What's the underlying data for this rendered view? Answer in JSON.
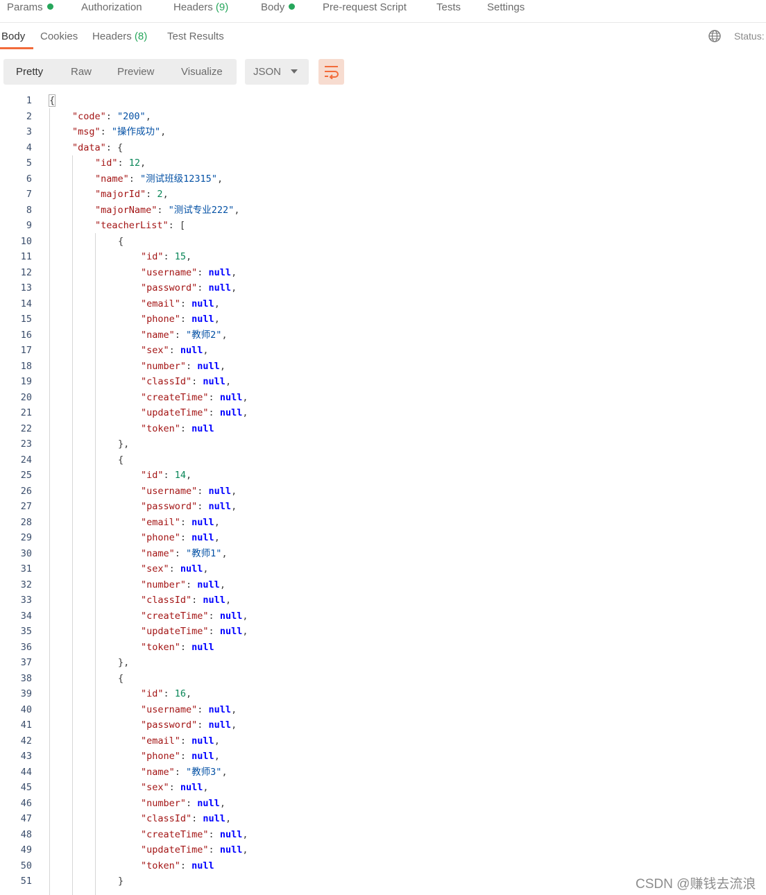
{
  "request_tabs": [
    {
      "label": "Params",
      "dot": true
    },
    {
      "label": "Authorization"
    },
    {
      "label": "Headers",
      "count": "(9)"
    },
    {
      "label": "Body",
      "dot": true
    },
    {
      "label": "Pre-request Script"
    },
    {
      "label": "Tests"
    },
    {
      "label": "Settings"
    }
  ],
  "response_tabs": [
    {
      "label": "Body",
      "active": true
    },
    {
      "label": "Cookies"
    },
    {
      "label": "Headers",
      "count": "(8)"
    },
    {
      "label": "Test Results"
    }
  ],
  "status_label": "Status:",
  "view_modes": [
    {
      "label": "Pretty",
      "active": true
    },
    {
      "label": "Raw"
    },
    {
      "label": "Preview"
    },
    {
      "label": "Visualize"
    }
  ],
  "format": {
    "selected": "JSON"
  },
  "icons": {
    "globe": "globe-icon",
    "wrap": "wrap-lines-icon",
    "format_caret": "chevron-down-icon"
  },
  "colors": {
    "accent": "#f26b3a",
    "count": "#26a65b",
    "key": "#a31515",
    "string": "#0451a5",
    "number": "#098658",
    "null": "#0000ff"
  },
  "code_lines": [
    [
      {
        "t": "p",
        "v": "{"
      }
    ],
    [
      {
        "t": "k",
        "v": "\"code\""
      },
      {
        "t": "p",
        "v": ": "
      },
      {
        "t": "s",
        "v": "\"200\""
      },
      {
        "t": "p",
        "v": ","
      }
    ],
    [
      {
        "t": "k",
        "v": "\"msg\""
      },
      {
        "t": "p",
        "v": ": "
      },
      {
        "t": "s",
        "v": "\"操作成功\""
      },
      {
        "t": "p",
        "v": ","
      }
    ],
    [
      {
        "t": "k",
        "v": "\"data\""
      },
      {
        "t": "p",
        "v": ": {"
      }
    ],
    [
      {
        "t": "k",
        "v": "\"id\""
      },
      {
        "t": "p",
        "v": ": "
      },
      {
        "t": "n",
        "v": "12"
      },
      {
        "t": "p",
        "v": ","
      }
    ],
    [
      {
        "t": "k",
        "v": "\"name\""
      },
      {
        "t": "p",
        "v": ": "
      },
      {
        "t": "s",
        "v": "\"测试班级12315\""
      },
      {
        "t": "p",
        "v": ","
      }
    ],
    [
      {
        "t": "k",
        "v": "\"majorId\""
      },
      {
        "t": "p",
        "v": ": "
      },
      {
        "t": "n",
        "v": "2"
      },
      {
        "t": "p",
        "v": ","
      }
    ],
    [
      {
        "t": "k",
        "v": "\"majorName\""
      },
      {
        "t": "p",
        "v": ": "
      },
      {
        "t": "s",
        "v": "\"测试专业222\""
      },
      {
        "t": "p",
        "v": ","
      }
    ],
    [
      {
        "t": "k",
        "v": "\"teacherList\""
      },
      {
        "t": "p",
        "v": ": ["
      }
    ],
    [
      {
        "t": "p",
        "v": "{"
      }
    ],
    [
      {
        "t": "k",
        "v": "\"id\""
      },
      {
        "t": "p",
        "v": ": "
      },
      {
        "t": "n",
        "v": "15"
      },
      {
        "t": "p",
        "v": ","
      }
    ],
    [
      {
        "t": "k",
        "v": "\"username\""
      },
      {
        "t": "p",
        "v": ": "
      },
      {
        "t": "x",
        "v": "null"
      },
      {
        "t": "p",
        "v": ","
      }
    ],
    [
      {
        "t": "k",
        "v": "\"password\""
      },
      {
        "t": "p",
        "v": ": "
      },
      {
        "t": "x",
        "v": "null"
      },
      {
        "t": "p",
        "v": ","
      }
    ],
    [
      {
        "t": "k",
        "v": "\"email\""
      },
      {
        "t": "p",
        "v": ": "
      },
      {
        "t": "x",
        "v": "null"
      },
      {
        "t": "p",
        "v": ","
      }
    ],
    [
      {
        "t": "k",
        "v": "\"phone\""
      },
      {
        "t": "p",
        "v": ": "
      },
      {
        "t": "x",
        "v": "null"
      },
      {
        "t": "p",
        "v": ","
      }
    ],
    [
      {
        "t": "k",
        "v": "\"name\""
      },
      {
        "t": "p",
        "v": ": "
      },
      {
        "t": "s",
        "v": "\"教师2\""
      },
      {
        "t": "p",
        "v": ","
      }
    ],
    [
      {
        "t": "k",
        "v": "\"sex\""
      },
      {
        "t": "p",
        "v": ": "
      },
      {
        "t": "x",
        "v": "null"
      },
      {
        "t": "p",
        "v": ","
      }
    ],
    [
      {
        "t": "k",
        "v": "\"number\""
      },
      {
        "t": "p",
        "v": ": "
      },
      {
        "t": "x",
        "v": "null"
      },
      {
        "t": "p",
        "v": ","
      }
    ],
    [
      {
        "t": "k",
        "v": "\"classId\""
      },
      {
        "t": "p",
        "v": ": "
      },
      {
        "t": "x",
        "v": "null"
      },
      {
        "t": "p",
        "v": ","
      }
    ],
    [
      {
        "t": "k",
        "v": "\"createTime\""
      },
      {
        "t": "p",
        "v": ": "
      },
      {
        "t": "x",
        "v": "null"
      },
      {
        "t": "p",
        "v": ","
      }
    ],
    [
      {
        "t": "k",
        "v": "\"updateTime\""
      },
      {
        "t": "p",
        "v": ": "
      },
      {
        "t": "x",
        "v": "null"
      },
      {
        "t": "p",
        "v": ","
      }
    ],
    [
      {
        "t": "k",
        "v": "\"token\""
      },
      {
        "t": "p",
        "v": ": "
      },
      {
        "t": "x",
        "v": "null"
      }
    ],
    [
      {
        "t": "p",
        "v": "},"
      }
    ],
    [
      {
        "t": "p",
        "v": "{"
      }
    ],
    [
      {
        "t": "k",
        "v": "\"id\""
      },
      {
        "t": "p",
        "v": ": "
      },
      {
        "t": "n",
        "v": "14"
      },
      {
        "t": "p",
        "v": ","
      }
    ],
    [
      {
        "t": "k",
        "v": "\"username\""
      },
      {
        "t": "p",
        "v": ": "
      },
      {
        "t": "x",
        "v": "null"
      },
      {
        "t": "p",
        "v": ","
      }
    ],
    [
      {
        "t": "k",
        "v": "\"password\""
      },
      {
        "t": "p",
        "v": ": "
      },
      {
        "t": "x",
        "v": "null"
      },
      {
        "t": "p",
        "v": ","
      }
    ],
    [
      {
        "t": "k",
        "v": "\"email\""
      },
      {
        "t": "p",
        "v": ": "
      },
      {
        "t": "x",
        "v": "null"
      },
      {
        "t": "p",
        "v": ","
      }
    ],
    [
      {
        "t": "k",
        "v": "\"phone\""
      },
      {
        "t": "p",
        "v": ": "
      },
      {
        "t": "x",
        "v": "null"
      },
      {
        "t": "p",
        "v": ","
      }
    ],
    [
      {
        "t": "k",
        "v": "\"name\""
      },
      {
        "t": "p",
        "v": ": "
      },
      {
        "t": "s",
        "v": "\"教师1\""
      },
      {
        "t": "p",
        "v": ","
      }
    ],
    [
      {
        "t": "k",
        "v": "\"sex\""
      },
      {
        "t": "p",
        "v": ": "
      },
      {
        "t": "x",
        "v": "null"
      },
      {
        "t": "p",
        "v": ","
      }
    ],
    [
      {
        "t": "k",
        "v": "\"number\""
      },
      {
        "t": "p",
        "v": ": "
      },
      {
        "t": "x",
        "v": "null"
      },
      {
        "t": "p",
        "v": ","
      }
    ],
    [
      {
        "t": "k",
        "v": "\"classId\""
      },
      {
        "t": "p",
        "v": ": "
      },
      {
        "t": "x",
        "v": "null"
      },
      {
        "t": "p",
        "v": ","
      }
    ],
    [
      {
        "t": "k",
        "v": "\"createTime\""
      },
      {
        "t": "p",
        "v": ": "
      },
      {
        "t": "x",
        "v": "null"
      },
      {
        "t": "p",
        "v": ","
      }
    ],
    [
      {
        "t": "k",
        "v": "\"updateTime\""
      },
      {
        "t": "p",
        "v": ": "
      },
      {
        "t": "x",
        "v": "null"
      },
      {
        "t": "p",
        "v": ","
      }
    ],
    [
      {
        "t": "k",
        "v": "\"token\""
      },
      {
        "t": "p",
        "v": ": "
      },
      {
        "t": "x",
        "v": "null"
      }
    ],
    [
      {
        "t": "p",
        "v": "},"
      }
    ],
    [
      {
        "t": "p",
        "v": "{"
      }
    ],
    [
      {
        "t": "k",
        "v": "\"id\""
      },
      {
        "t": "p",
        "v": ": "
      },
      {
        "t": "n",
        "v": "16"
      },
      {
        "t": "p",
        "v": ","
      }
    ],
    [
      {
        "t": "k",
        "v": "\"username\""
      },
      {
        "t": "p",
        "v": ": "
      },
      {
        "t": "x",
        "v": "null"
      },
      {
        "t": "p",
        "v": ","
      }
    ],
    [
      {
        "t": "k",
        "v": "\"password\""
      },
      {
        "t": "p",
        "v": ": "
      },
      {
        "t": "x",
        "v": "null"
      },
      {
        "t": "p",
        "v": ","
      }
    ],
    [
      {
        "t": "k",
        "v": "\"email\""
      },
      {
        "t": "p",
        "v": ": "
      },
      {
        "t": "x",
        "v": "null"
      },
      {
        "t": "p",
        "v": ","
      }
    ],
    [
      {
        "t": "k",
        "v": "\"phone\""
      },
      {
        "t": "p",
        "v": ": "
      },
      {
        "t": "x",
        "v": "null"
      },
      {
        "t": "p",
        "v": ","
      }
    ],
    [
      {
        "t": "k",
        "v": "\"name\""
      },
      {
        "t": "p",
        "v": ": "
      },
      {
        "t": "s",
        "v": "\"教师3\""
      },
      {
        "t": "p",
        "v": ","
      }
    ],
    [
      {
        "t": "k",
        "v": "\"sex\""
      },
      {
        "t": "p",
        "v": ": "
      },
      {
        "t": "x",
        "v": "null"
      },
      {
        "t": "p",
        "v": ","
      }
    ],
    [
      {
        "t": "k",
        "v": "\"number\""
      },
      {
        "t": "p",
        "v": ": "
      },
      {
        "t": "x",
        "v": "null"
      },
      {
        "t": "p",
        "v": ","
      }
    ],
    [
      {
        "t": "k",
        "v": "\"classId\""
      },
      {
        "t": "p",
        "v": ": "
      },
      {
        "t": "x",
        "v": "null"
      },
      {
        "t": "p",
        "v": ","
      }
    ],
    [
      {
        "t": "k",
        "v": "\"createTime\""
      },
      {
        "t": "p",
        "v": ": "
      },
      {
        "t": "x",
        "v": "null"
      },
      {
        "t": "p",
        "v": ","
      }
    ],
    [
      {
        "t": "k",
        "v": "\"updateTime\""
      },
      {
        "t": "p",
        "v": ": "
      },
      {
        "t": "x",
        "v": "null"
      },
      {
        "t": "p",
        "v": ","
      }
    ],
    [
      {
        "t": "k",
        "v": "\"token\""
      },
      {
        "t": "p",
        "v": ": "
      },
      {
        "t": "x",
        "v": "null"
      }
    ],
    [
      {
        "t": "p",
        "v": "}"
      }
    ]
  ],
  "watermark": "CSDN @赚钱去流浪"
}
